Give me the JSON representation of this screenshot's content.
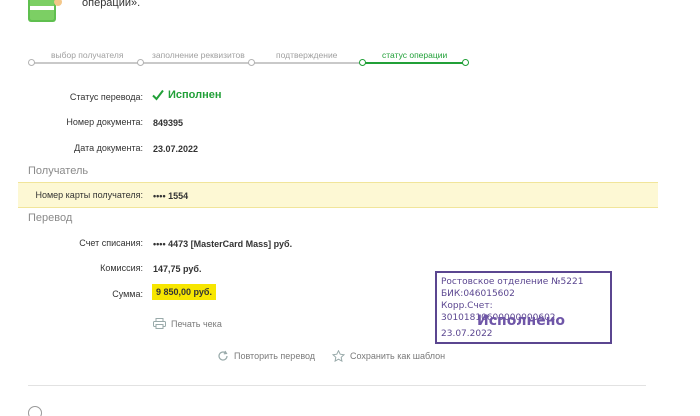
{
  "header": {
    "fragment_text": "операции»."
  },
  "stepper": {
    "steps": [
      {
        "label": "выбор получателя"
      },
      {
        "label": "заполнение реквизитов"
      },
      {
        "label": "подтверждение"
      },
      {
        "label": "статус операции"
      }
    ],
    "active_index": 3
  },
  "details": {
    "status_label": "Статус перевода:",
    "status_value": "Исполнен",
    "doc_number_label": "Номер документа:",
    "doc_number_value": "849395",
    "doc_date_label": "Дата документа:",
    "doc_date_value": "23.07.2022"
  },
  "recipient": {
    "section_title": "Получатель",
    "card_label": "Номер карты получателя:",
    "card_value": "•••• 1554"
  },
  "transfer": {
    "section_title": "Перевод",
    "account_label": "Счет списания:",
    "account_value": "•••• 4473  [MasterCard Mass]  руб.",
    "fee_label": "Комиссия:",
    "fee_value": "147,75 руб.",
    "sum_label": "Сумма:",
    "sum_value": "9 850,00  руб."
  },
  "actions": {
    "print_label": "Печать чека",
    "repeat_label": "Повторить перевод",
    "template_label": "Сохранить как шаблон"
  },
  "stamp": {
    "line1": "Ростовское отделение №5221",
    "line2": "БИК:046015602",
    "line3": "Корр.Счет: 30101810600000000602",
    "line4": "23.07.2022",
    "big": "Исполнено",
    "color": "#5b4690"
  },
  "colors": {
    "accent_green": "#21a038",
    "highlight_yellow": "#f7e600",
    "row_highlight": "#fdf8d4"
  }
}
